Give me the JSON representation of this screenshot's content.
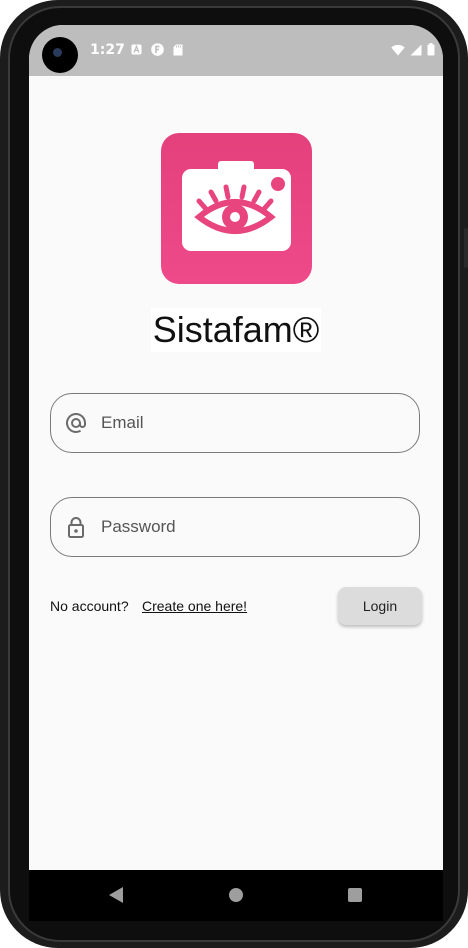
{
  "status_bar": {
    "time": "1:27",
    "icons_left": [
      "a-icon",
      "f-icon",
      "sd-card-icon"
    ],
    "icons_right": [
      "wifi-icon",
      "signal-icon",
      "battery-icon"
    ]
  },
  "app": {
    "title": "Sistafam®",
    "logo_icon": "camera-eye-icon",
    "colors": {
      "brand_pink": "#e4407c",
      "status_bar": "#bdbdbd",
      "background": "#fafafa"
    }
  },
  "form": {
    "email": {
      "placeholder": "Email",
      "value": "",
      "icon": "at-sign-icon"
    },
    "password": {
      "placeholder": "Password",
      "value": "",
      "icon": "lock-icon"
    }
  },
  "footer": {
    "no_account_text": "No account?",
    "create_link_text": "Create one here!",
    "login_label": "Login"
  },
  "nav_bar": {
    "icons": [
      "back-icon",
      "home-icon",
      "recents-icon"
    ]
  }
}
